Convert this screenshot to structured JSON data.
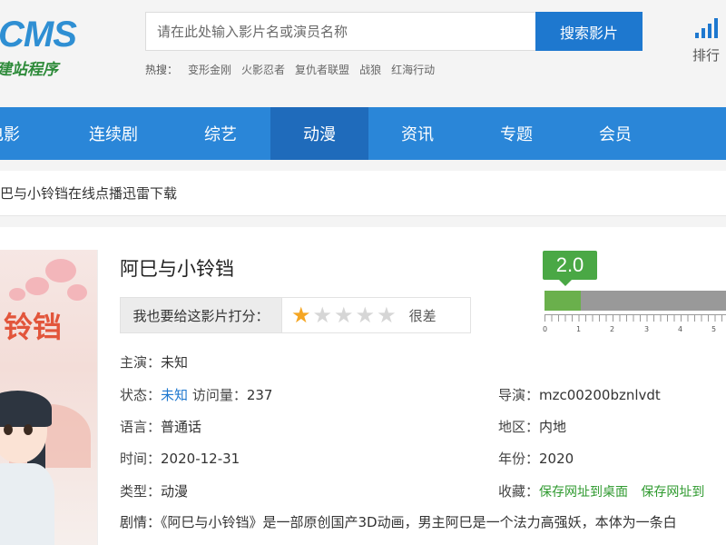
{
  "header": {
    "logo_main_a": "CMS",
    "logo_sub": "建站程序",
    "search_placeholder": "请在此处输入影片名或演员名称",
    "search_button": "搜索影片",
    "hot_label": "热搜：",
    "hot_items": [
      "变形金刚",
      "火影忍者",
      "复仇者联盟",
      "战狼",
      "红海行动"
    ],
    "rank_label": "排行"
  },
  "nav": {
    "items": [
      "电影",
      "连续剧",
      "综艺",
      "动漫",
      "资讯",
      "专题",
      "会员"
    ],
    "active": "动漫"
  },
  "breadcrumb": "巴与小铃铛在线点播迅雷下载",
  "movie": {
    "poster_text": "铃铛",
    "title": "阿巳与小铃铛",
    "rate_prompt": "我也要给这影片打分：",
    "rate_text": "很差",
    "stars_on": 1,
    "stars_total": 5,
    "score": "2.0",
    "score_fraction": 0.2,
    "score_ticks": [
      "0",
      "1",
      "2",
      "3",
      "4",
      "5"
    ],
    "fields": {
      "actor_label": "主演：",
      "actor": "未知",
      "status_label": "状态：",
      "status": "未知",
      "views_label": "访问量：",
      "views": "237",
      "director_label": "导演：",
      "director": "mzc00200bznlvdt",
      "language_label": "语言：",
      "language": "普通话",
      "region_label": "地区：",
      "region": "内地",
      "time_label": "时间：",
      "time": "2020-12-31",
      "year_label": "年份：",
      "year": "2020",
      "type_label": "类型：",
      "type": "动漫",
      "fav_label": "收藏：",
      "fav1": "保存网址到桌面",
      "fav2": "保存网址到",
      "plot_label": "剧情：",
      "plot": "《阿巳与小铃铛》是一部原创国产3D动画，男主阿巳是一个法力高强妖，本体为一条白"
    }
  },
  "colors": {
    "primary": "#2a86d8",
    "nav_active": "#1f6bbb",
    "score_green": "#4aa845",
    "star": "#f5a623"
  }
}
